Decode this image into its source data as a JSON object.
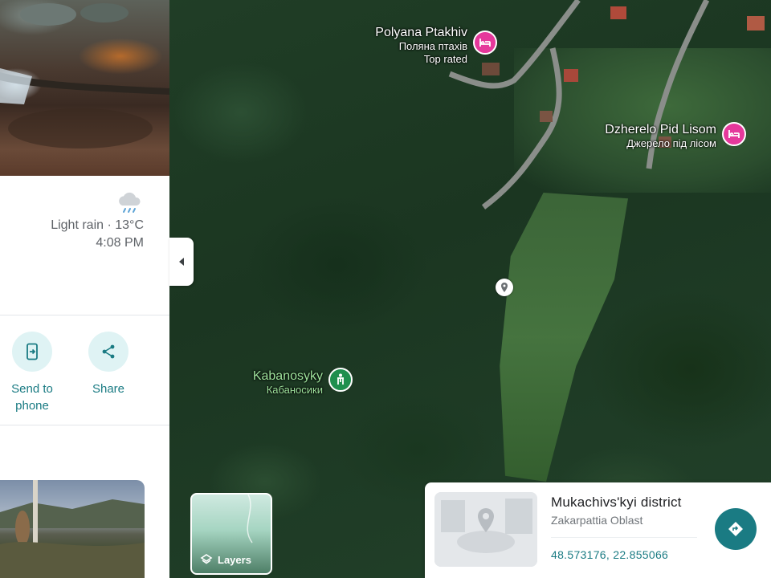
{
  "side_panel": {
    "weather": {
      "icon": "rain-cloud-icon",
      "condition": "Light rain · 13°C",
      "time": "4:08 PM"
    },
    "actions": [
      {
        "label_line1": "Send to",
        "label_line2": "phone",
        "icon": "send-to-phone-icon"
      },
      {
        "label_line1": "Share",
        "label_line2": "",
        "icon": "share-icon"
      }
    ]
  },
  "map": {
    "places": [
      {
        "name": "Polyana Ptakhiv",
        "native": "Поляна птахів",
        "extra": "Top rated",
        "icon": "hotel-icon",
        "color": "#e5389b"
      },
      {
        "name": "Dzherelo Pid Lisom",
        "native": "Джерело під лісом",
        "icon": "hotel-icon",
        "color": "#e5389b"
      },
      {
        "name": "Kabanosyky",
        "native": "Кабаносики",
        "icon": "park-icon",
        "color": "#1e8f4e"
      }
    ],
    "layers_label": "Layers"
  },
  "info_card": {
    "title": "Mukachivs'kyi district",
    "subtitle": "Zakarpattia Oblast",
    "coordinates": "48.573176, 22.855066",
    "accent": "#1a7b83"
  }
}
